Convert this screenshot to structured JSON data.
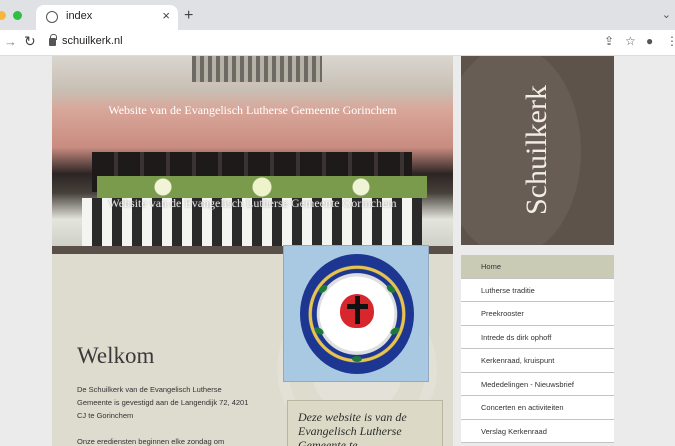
{
  "browser": {
    "tab_title": "index",
    "tab_close": "×",
    "new_tab": "+",
    "chevron": "⌄",
    "url": "schuilkerk.nl",
    "icons": [
      "back-arrow-icon",
      "reload-icon",
      "lock-icon",
      "share-icon",
      "star-icon",
      "profile-icon",
      "menu-dots-icon"
    ],
    "traffic_colors": [
      "#f5b83d",
      "#2fbf45"
    ]
  },
  "hero": {
    "title": "Website van de Evangelisch Lutherse Gemeente Gorinchem",
    "title_reflection": "Website van de Evangelisch Lutherse Gemeente Gorinchem"
  },
  "welcome": {
    "title": "Welkom",
    "text": "De Schuilkerk van de Evangelisch Lutherse Gemeente is gevestigd aan de Langendijk 72, 4201 CJ te Gorinchem",
    "text_2": "Onze erediensten beginnen elke zondag om"
  },
  "quote": {
    "text": "Deze website is van de Evangelisch Lutherse Gemeente te"
  },
  "sidebar": {
    "title": "Schuilkerk",
    "menu": [
      {
        "label": "Home"
      },
      {
        "label": "Lutherse traditie"
      },
      {
        "label": "Preekrooster"
      },
      {
        "label": "Intrede ds dirk ophoff"
      },
      {
        "label": "Kerkenraad, kruispunt"
      },
      {
        "label": "Mededelingen - Nieuwsbrief"
      },
      {
        "label": "Concerten en activiteiten"
      },
      {
        "label": "Verslag Kerkenraad"
      }
    ]
  },
  "colors": {
    "sidebar_brown": "#5e534a",
    "menu_active": "#c9cbb4",
    "content_beige": "#dedbcf",
    "luther_blue": "#1c3691",
    "luther_red": "#d8262d"
  }
}
